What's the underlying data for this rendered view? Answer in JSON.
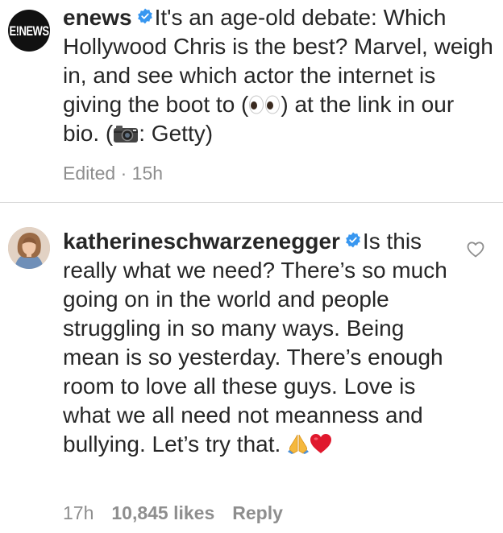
{
  "caption": {
    "avatar_label": "E!NEWS",
    "username": "enews",
    "text_part1": "It's an age-old debate: Which Hollywood Chris is the best? Marvel, weigh in, and see which actor the internet is giving the boot to (",
    "text_part2": ") at the link in our bio. (",
    "text_part3": ": Getty)",
    "emoji_1": "eyes-emoji",
    "emoji_2": "camera-emoji",
    "edited_label": "Edited · 15h"
  },
  "comment": {
    "username": "katherineschwarzenegger",
    "text": "Is this really what we need? There’s so much going on in the world and people struggling in so many ways. Being mean is so yesterday. There’s enough room to love all these guys. Love is what we all need not meanness and bullying. Let’s try that.",
    "emoji_1": "folded-hands-emoji",
    "emoji_2": "red-heart-emoji",
    "time": "17h",
    "likes": "10,845 likes",
    "reply": "Reply"
  },
  "colors": {
    "text": "#262626",
    "meta": "#8e8e8e",
    "verified": "#3897f0",
    "divider": "#dbdbdb",
    "heart_emoji": "#e0182d"
  }
}
